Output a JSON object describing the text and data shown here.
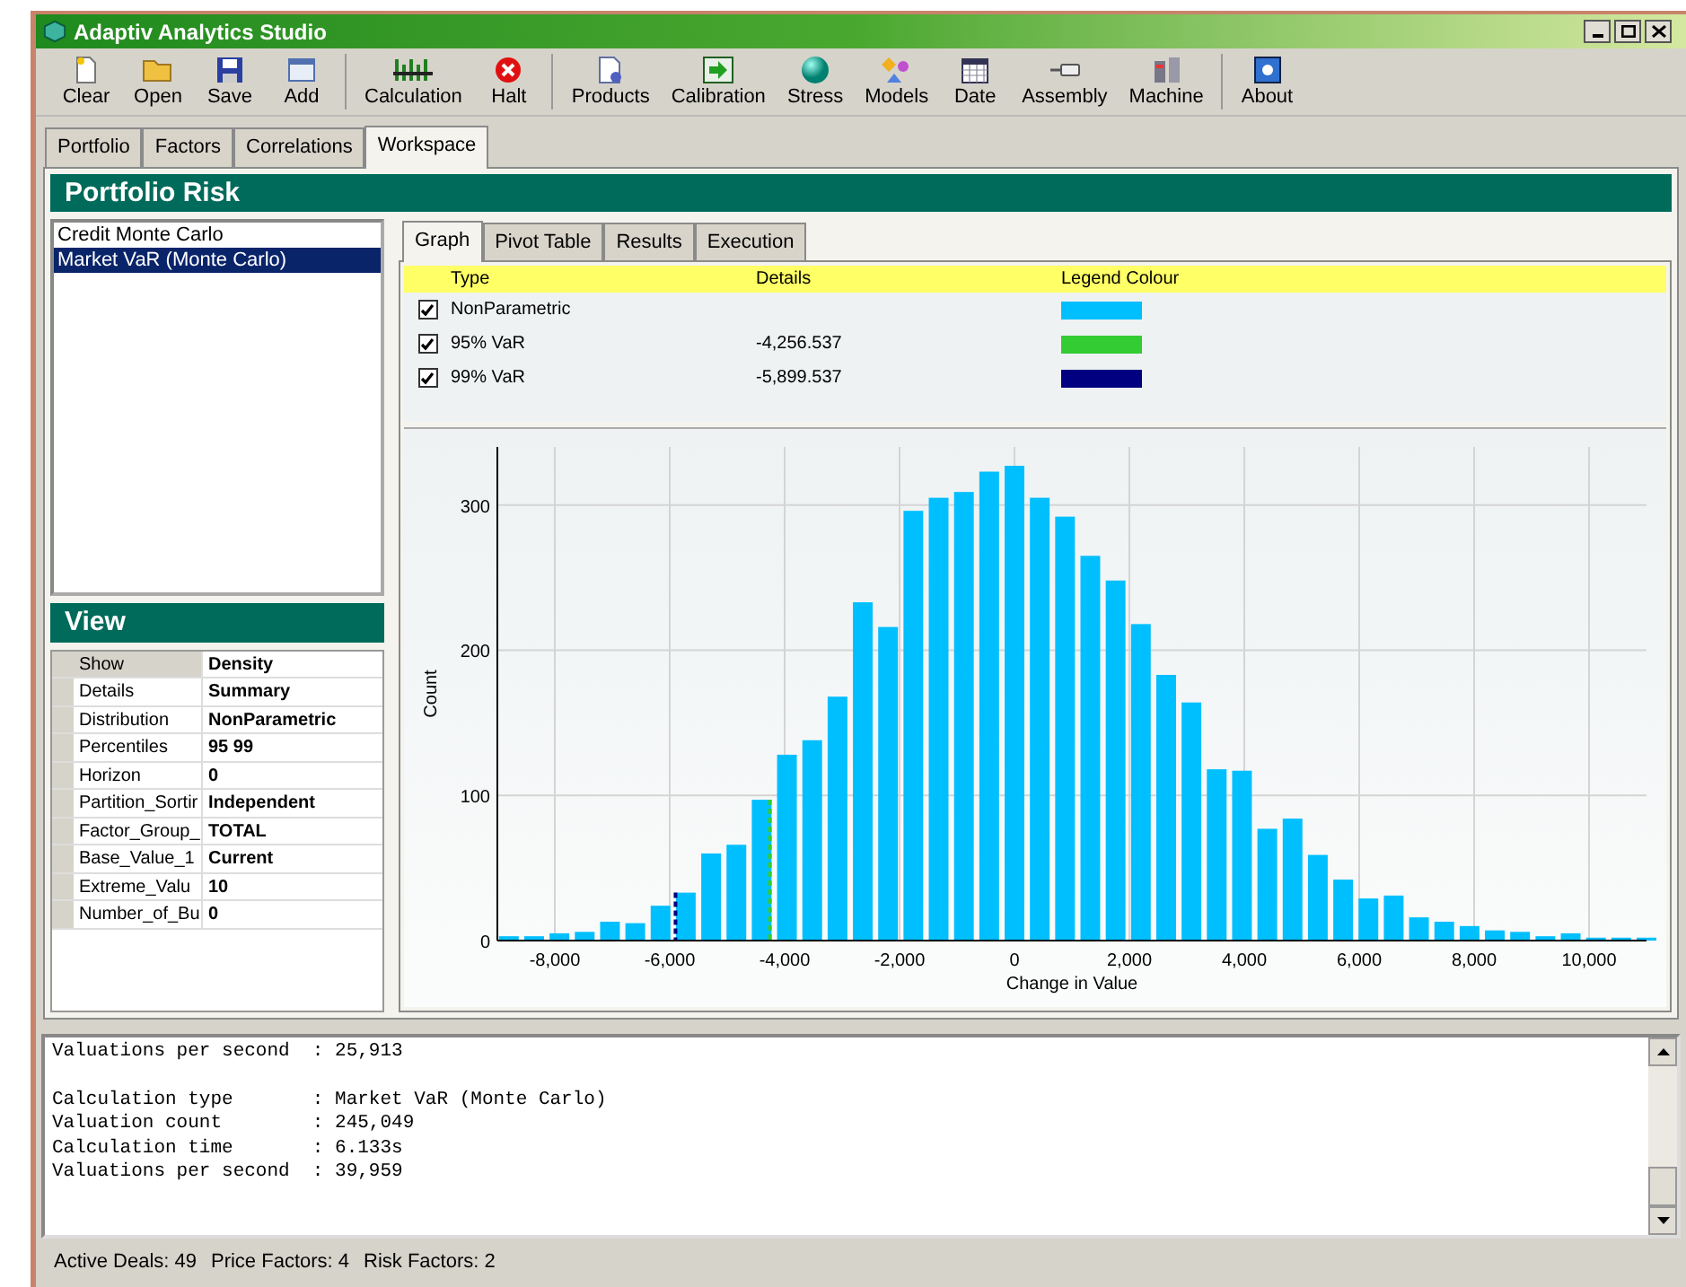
{
  "window": {
    "title": "Adaptiv Analytics Studio"
  },
  "toolbar": {
    "groups": [
      [
        {
          "label": "Clear"
        },
        {
          "label": "Open"
        },
        {
          "label": "Save"
        },
        {
          "label": "Add"
        }
      ],
      [
        {
          "label": "Calculation"
        },
        {
          "label": "Halt"
        }
      ],
      [
        {
          "label": "Products"
        },
        {
          "label": "Calibration"
        },
        {
          "label": "Stress"
        },
        {
          "label": "Models"
        },
        {
          "label": "Date"
        },
        {
          "label": "Assembly"
        },
        {
          "label": "Machine"
        }
      ],
      [
        {
          "label": "About"
        }
      ]
    ]
  },
  "tabs": [
    {
      "label": "Portfolio",
      "selected": false
    },
    {
      "label": "Factors",
      "selected": false
    },
    {
      "label": "Correlations",
      "selected": false
    },
    {
      "label": "Workspace",
      "selected": true
    }
  ],
  "panel_title": "Portfolio Risk",
  "calculations": [
    {
      "label": "Credit Monte Carlo",
      "selected": false
    },
    {
      "label": "Market VaR (Monte Carlo)",
      "selected": true
    }
  ],
  "view": {
    "title": "View",
    "properties": [
      {
        "name": "Show",
        "value": "Density"
      },
      {
        "name": "Details",
        "value": "Summary"
      },
      {
        "name": "Distribution",
        "value": "NonParametric"
      },
      {
        "name": "Percentiles",
        "value": "95 99"
      },
      {
        "name": "Horizon",
        "value": "0"
      },
      {
        "name": "Partition_Sortir",
        "value": "Independent"
      },
      {
        "name": "Factor_Group_",
        "value": "TOTAL"
      },
      {
        "name": "Base_Value_1",
        "value": "Current"
      },
      {
        "name": "Extreme_Valu",
        "value": "10"
      },
      {
        "name": "Number_of_Bu",
        "value": "0"
      }
    ]
  },
  "result_tabs": [
    {
      "label": "Graph",
      "selected": true
    },
    {
      "label": "Pivot Table",
      "selected": false
    },
    {
      "label": "Results",
      "selected": false
    },
    {
      "label": "Execution",
      "selected": false
    }
  ],
  "legend": {
    "columns": [
      "Type",
      "Details",
      "Legend Colour"
    ],
    "rows": [
      {
        "type": "NonParametric",
        "checked": true,
        "color": "#00bfff"
      },
      {
        "type": "95% VaR",
        "details": "-4,256.537",
        "checked": true,
        "color": "#33cc33"
      },
      {
        "type": "99% VaR",
        "details": "-5,899.537",
        "checked": true,
        "color": "#000080"
      }
    ]
  },
  "chart_data": {
    "type": "bar",
    "xlabel": "Change in Value",
    "ylabel": "Count",
    "xlim": [
      -9000,
      11000
    ],
    "ylim": [
      0,
      340
    ],
    "x": [
      -8800,
      -8360,
      -7920,
      -7480,
      -7040,
      -6600,
      -6160,
      -5720,
      -5280,
      -4840,
      -4400,
      -3960,
      -3520,
      -3080,
      -2640,
      -2200,
      -1760,
      -1320,
      -880,
      -440,
      0,
      440,
      880,
      1320,
      1760,
      2200,
      2640,
      3080,
      3520,
      3960,
      4400,
      4840,
      5280,
      5720,
      6160,
      6600,
      7040,
      7480,
      7920,
      8360,
      8800,
      9240,
      9680,
      10120,
      10560,
      11000
    ],
    "series": [
      {
        "color": "#00bfff",
        "values": [
          3,
          3,
          5,
          6,
          13,
          12,
          24,
          33,
          60,
          66,
          97,
          128,
          138,
          168,
          233,
          216,
          296,
          305,
          309,
          323,
          327,
          305,
          292,
          265,
          248,
          218,
          183,
          164,
          118,
          117,
          77,
          84,
          59,
          42,
          29,
          31,
          16,
          13,
          10,
          7,
          6,
          3,
          5,
          2,
          2,
          2
        ]
      }
    ],
    "xticks": [
      {
        "value": -8000,
        "label": "-8,000"
      },
      {
        "value": -6000,
        "label": "-6,000"
      },
      {
        "value": -4000,
        "label": "-4,000"
      },
      {
        "value": -2000,
        "label": "-2,000"
      },
      {
        "value": 0,
        "label": "0"
      },
      {
        "value": 2000,
        "label": "2,000"
      },
      {
        "value": 4000,
        "label": "4,000"
      },
      {
        "value": 6000,
        "label": "6,000"
      },
      {
        "value": 8000,
        "label": "8,000"
      },
      {
        "value": 10000,
        "label": "10,000"
      }
    ],
    "yticks": [
      0,
      100,
      200,
      300
    ],
    "grid": true,
    "ref_lines": [
      {
        "axis": "x",
        "value": -4256.537,
        "color": "#33cc33"
      },
      {
        "axis": "x",
        "value": -5899.537,
        "color": "#000080"
      }
    ]
  },
  "log": [
    [
      "Valuations per second  : 25,913"
    ],
    [
      "Calculation type       : Market VaR (Monte Carlo)",
      "Valuation count        : 245,049",
      "Calculation time       : 6.133s",
      "Valuations per second  : 39,959"
    ]
  ],
  "status_bar": [
    "Active Deals: 49",
    "Price Factors: 4",
    "Risk Factors: 2"
  ]
}
